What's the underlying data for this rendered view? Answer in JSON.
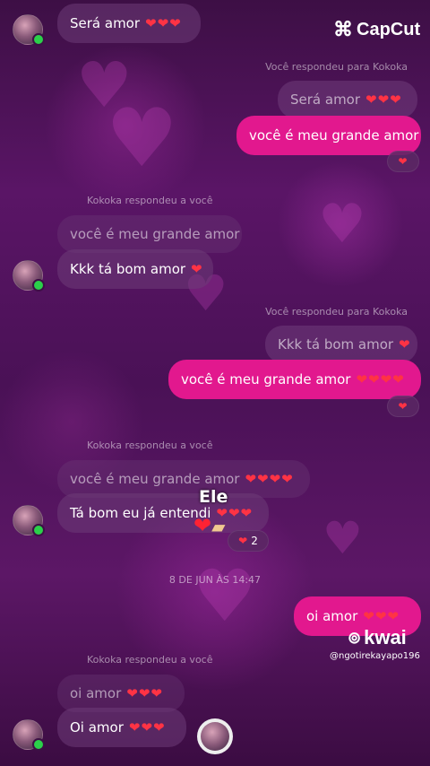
{
  "watermarks": {
    "capcut_label": "CapCut",
    "kwai_label": "kwai",
    "kwai_handle": "@ngotirekayapo196"
  },
  "overlay": {
    "caption": "Ele"
  },
  "heart_emoji": "❤️",
  "messages": {
    "m1": {
      "text": "Será amor",
      "hearts": "❤❤❤"
    },
    "reply1": {
      "meta": "Você respondeu para Kokoka",
      "quote_text": "Será amor",
      "quote_hearts": "❤❤❤",
      "text": "você é meu grande amor",
      "reaction": "❤"
    },
    "reply2": {
      "meta": "Kokoka respondeu a você",
      "quote_text": "você é meu grande amor",
      "text": "Kkk tá bom amor",
      "hearts": "❤"
    },
    "reply3": {
      "meta": "Você respondeu para Kokoka",
      "quote_text": "Kkk tá bom amor",
      "quote_hearts": "❤",
      "text": "você é meu grande amor",
      "hearts": "❤❤❤❤",
      "reaction": "❤"
    },
    "reply4": {
      "meta": "Kokoka respondeu a você",
      "quote_text": "você é meu grande amor",
      "quote_hearts": "❤❤❤❤",
      "text": "Tá bom eu já entendi",
      "hearts": "❤❤❤",
      "reaction_hearts": "❤",
      "reaction_count": "2"
    },
    "date_divider": "8 DE JUN ÀS 14:47",
    "m5": {
      "text": "oi amor",
      "hearts": "❤❤❤"
    },
    "reply6": {
      "meta": "Kokoka respondeu a você",
      "quote_text": "oi amor",
      "quote_hearts": "❤❤❤",
      "text": "Oi amor",
      "hearts": "❤❤❤"
    }
  }
}
